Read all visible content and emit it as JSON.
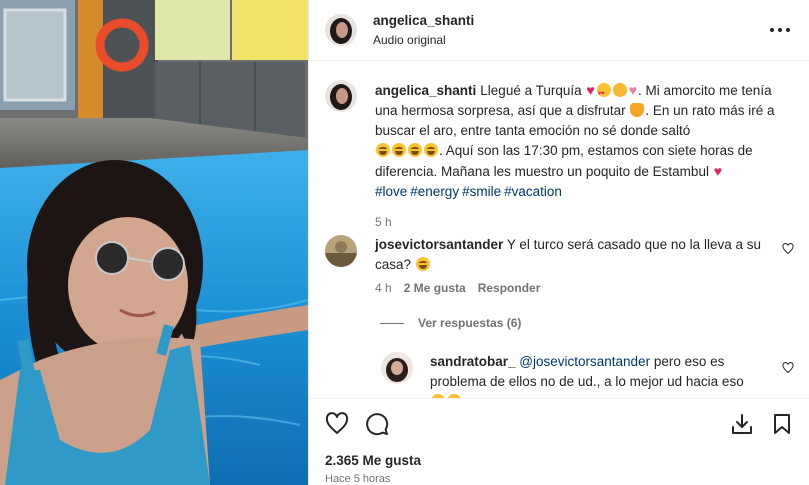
{
  "post": {
    "author": "angelica_shanti",
    "audio": "Audio original"
  },
  "caption": {
    "username": "angelica_shanti",
    "part1": "Llegué a Turquía",
    "part2": ". Mi amorcito me tenía una hermosa sorpresa, así que a disfrutar",
    "part3": ". En un rato más iré a buscar el aro, entre tanta emoción no sé donde saltó",
    "part4": ". Aquí son las 17:30 pm, estamos con siete horas de diferencia. Mañana les muestro un poquito de Estambul",
    "hashtags": [
      "#love",
      "#energy",
      "#smile",
      "#vacation"
    ],
    "time": "5 h"
  },
  "comment1": {
    "username": "josevictorsantander",
    "text": "Y el turco será casado que no la lleva a su casa?",
    "time": "4 h",
    "likes": "2 Me gusta",
    "reply": "Responder",
    "view_replies": "Ver respuestas (6)"
  },
  "comment2": {
    "username": "sandratobar_",
    "mention": "@josevictorsantander",
    "text": "pero eso es problema de ellos no de ud., a lo mejor ud hacia eso"
  },
  "footer": {
    "likes": "2.365 Me gusta",
    "time_ago": "Hace 5 horas"
  },
  "icons": {
    "more": "more-horizontal-icon",
    "like": "heart-icon",
    "comment": "comment-bubble-icon",
    "share": "download-share-icon",
    "save": "bookmark-icon"
  },
  "colors": {
    "link": "#00376b",
    "muted": "#737373",
    "text": "#262626",
    "heart_emoji": "#e0245e",
    "pool_water": "#1f8fd0"
  }
}
